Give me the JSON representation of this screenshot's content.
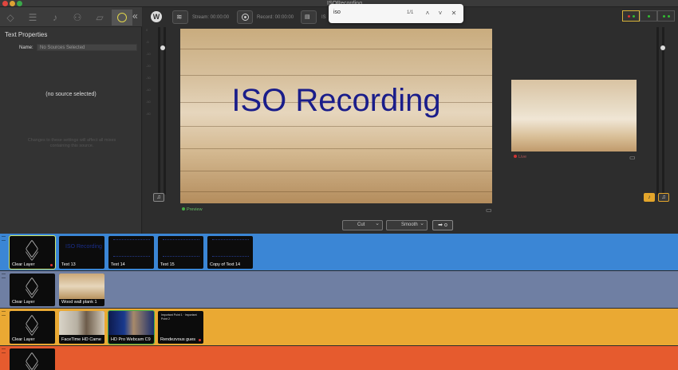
{
  "window": {
    "title": "ISORecording"
  },
  "left_panel": {
    "title": "Text Properties",
    "name_label": "Name:",
    "name_placeholder": "No Sources Selected",
    "empty_message": "(no source selected)",
    "hint": "Changes to these settings will affect all mixes containing this source."
  },
  "toolbar": {
    "stream_label": "Stream: 00:00:00",
    "record_label": "Record: 00:00:00",
    "iso_label": "IS"
  },
  "find_bar": {
    "query": "iso",
    "count": "1/1"
  },
  "preview": {
    "title": "ISO Recording",
    "label": "Preview"
  },
  "live": {
    "label": "Live"
  },
  "transition": {
    "type": "Cut",
    "speed": "Smooth",
    "go_label": "➡ o"
  },
  "colors": {
    "layer1": "#3b86d5",
    "layer2": "#6f7fa3",
    "layer3": "#eaa933",
    "layer4": "#e65b2e",
    "accent": "#e3d24a"
  },
  "layers": [
    {
      "name": "layer-1",
      "sources": [
        {
          "label": "Clear Layer",
          "kind": "clear"
        },
        {
          "label": "Text 13",
          "kind": "text"
        },
        {
          "label": "Text 14",
          "kind": "lines"
        },
        {
          "label": "Text 15",
          "kind": "lines"
        },
        {
          "label": "Copy of Text 14",
          "kind": "lines"
        }
      ]
    },
    {
      "name": "layer-2",
      "sources": [
        {
          "label": "Clear Layer",
          "kind": "clear"
        },
        {
          "label": "Wood wall plank 1",
          "kind": "wood"
        }
      ]
    },
    {
      "name": "layer-3",
      "sources": [
        {
          "label": "Clear Layer",
          "kind": "clear"
        },
        {
          "label": "FaceTime HD Came",
          "kind": "cam"
        },
        {
          "label": "HD Pro Webcam C9",
          "kind": "cam2"
        },
        {
          "label": "Rendezvous gues",
          "kind": "notes"
        }
      ]
    },
    {
      "name": "layer-4",
      "sources": [
        {
          "label": "Clear Layer",
          "kind": "clear"
        }
      ]
    }
  ],
  "tile_preview_text": "ISO Recording",
  "notes_text": "Important Point 1 · Important Point 2"
}
